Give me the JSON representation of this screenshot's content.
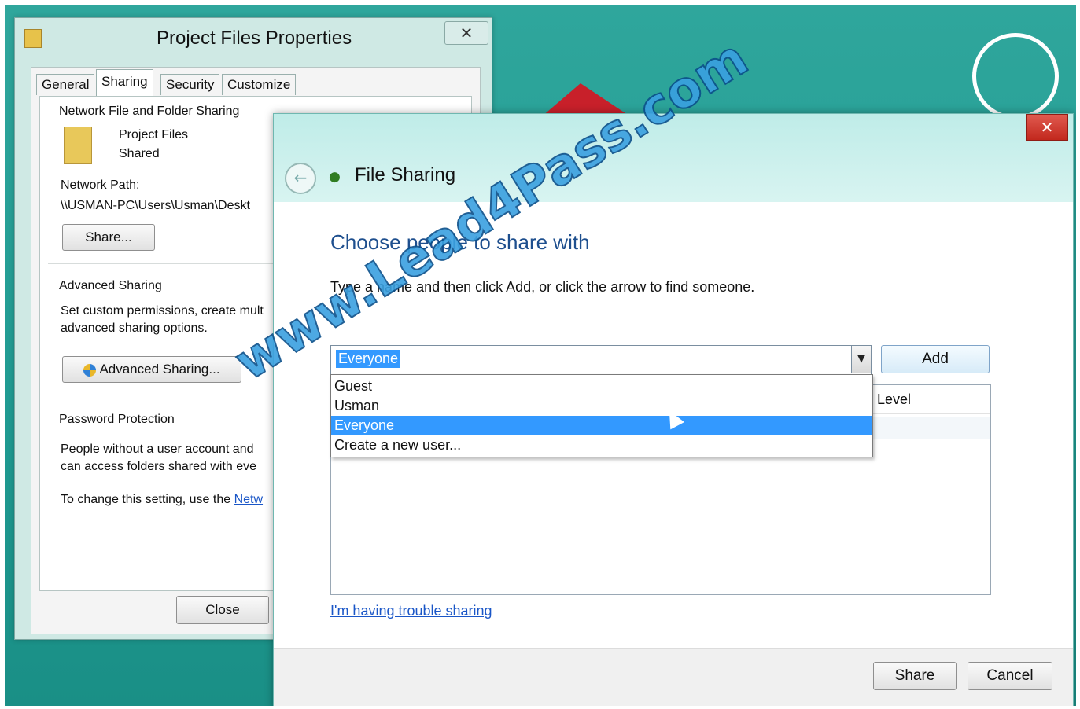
{
  "properties_window": {
    "title": "Project Files Properties",
    "close_glyph": "✕",
    "tabs": [
      "General",
      "Sharing",
      "Security",
      "Customize"
    ],
    "active_tab": "Sharing",
    "network_sharing": {
      "group_label": "Network File and Folder Sharing",
      "folder_name": "Project Files",
      "folder_status": "Shared",
      "network_path_label": "Network Path:",
      "network_path_value": "\\\\USMAN-PC\\Users\\Usman\\Deskt",
      "share_button": "Share..."
    },
    "advanced_sharing": {
      "group_label": "Advanced Sharing",
      "description_line1": "Set custom permissions, create mult",
      "description_line2": "advanced sharing options.",
      "button": "Advanced Sharing..."
    },
    "password_protection": {
      "group_label": "Password Protection",
      "line1": "People without a user account and",
      "line2": "can access folders shared with eve",
      "line3_prefix": "To change this setting, use the ",
      "line3_link": "Netw"
    },
    "close_button": "Close"
  },
  "file_sharing_dialog": {
    "title": "File Sharing",
    "close_glyph": "✕",
    "back_glyph": "←",
    "heading": "Choose people to share with",
    "instruction": "Type a name and then click Add, or click the arrow to find someone.",
    "combo_value": "Everyone",
    "combo_arrow_glyph": "▼",
    "add_button": "Add",
    "dropdown_options": [
      "Guest",
      "Usman",
      "Everyone",
      "Create a new user..."
    ],
    "selected_option": "Everyone",
    "list_column_level": "Level",
    "trouble_link": "I'm having trouble sharing",
    "share_button": "Share",
    "cancel_button": "Cancel"
  },
  "watermark_text": "www.Lead4Pass.com"
}
